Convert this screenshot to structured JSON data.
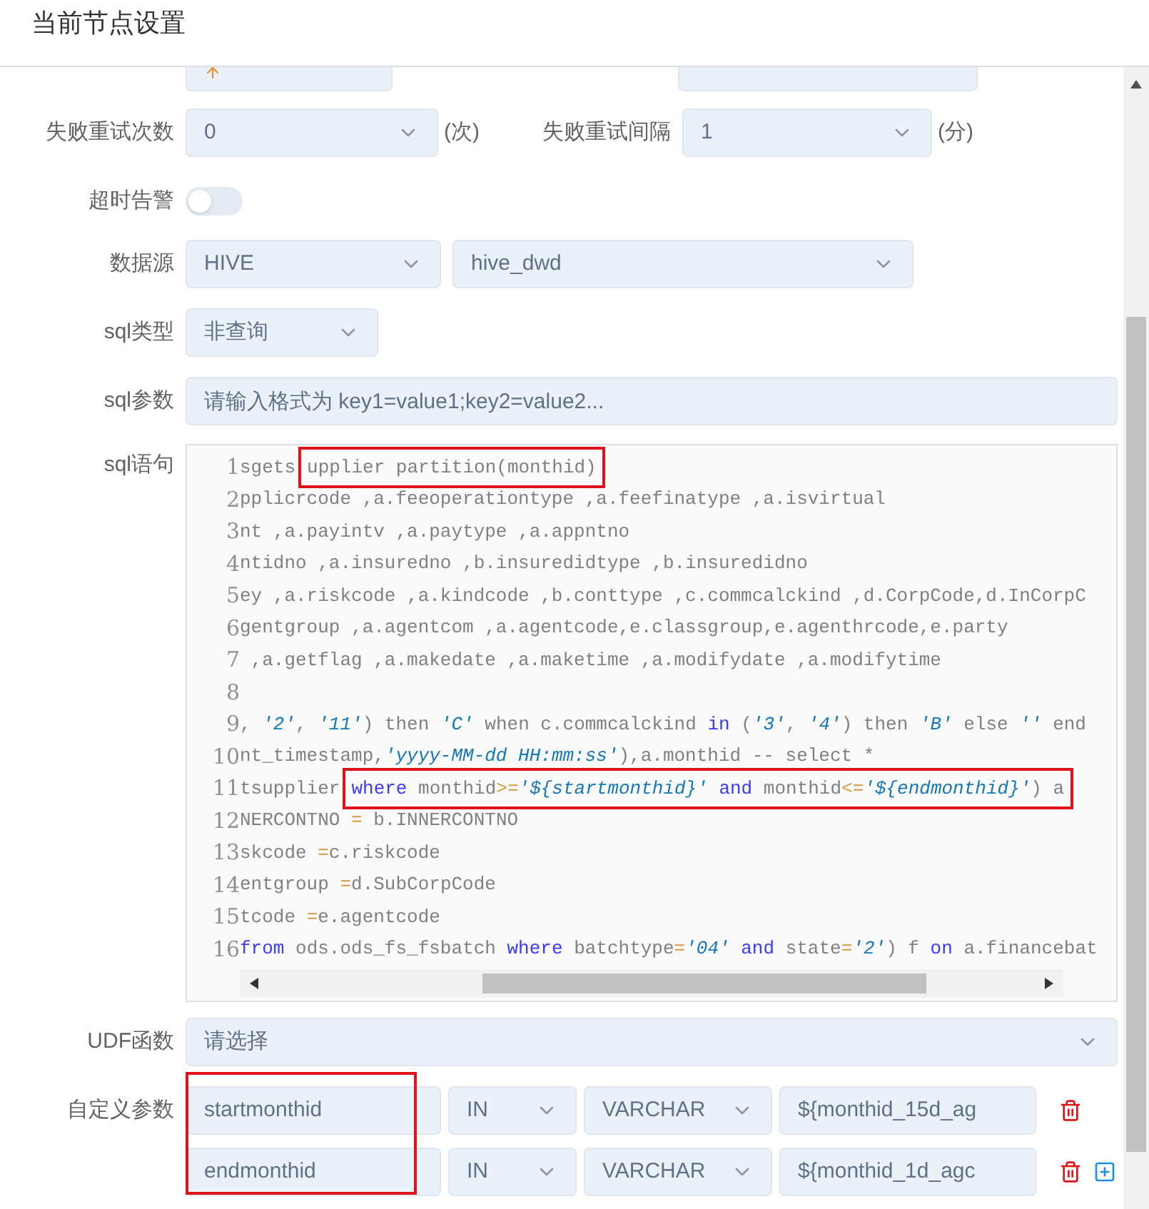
{
  "header": {
    "title": "当前节点设置"
  },
  "form": {
    "retry_row": {
      "retries_label": "失败重试次数",
      "retries_value": "0",
      "retries_unit": "(次)",
      "interval_label": "失败重试间隔",
      "interval_value": "1",
      "interval_unit": "(分)"
    },
    "timeout_alarm": {
      "label": "超时告警",
      "on": false
    },
    "datasource": {
      "label": "数据源",
      "type": "HIVE",
      "name": "hive_dwd"
    },
    "sql_type": {
      "label": "sql类型",
      "value": "非查询"
    },
    "sql_params": {
      "label": "sql参数",
      "placeholder": "请输入格式为 key1=value1;key2=value2..."
    },
    "sql_statement": {
      "label": "sql语句",
      "lines": [
        {
          "number": "1",
          "parts": [
            {
              "boxed": false,
              "tokens": [
                {
                  "text": "sgets",
                  "kind": "plain"
                }
              ]
            },
            {
              "boxed": true,
              "tokens": [
                {
                  "text": "upplier partition(monthid)",
                  "kind": "plain"
                }
              ]
            }
          ]
        },
        {
          "number": "2",
          "parts": [
            {
              "boxed": false,
              "tokens": [
                {
                  "text": "pplicrcode ,a.feeoperationtype ,a.feefinatype ,a.isvirtual",
                  "kind": "plain"
                }
              ]
            }
          ]
        },
        {
          "number": "3",
          "parts": [
            {
              "boxed": false,
              "tokens": [
                {
                  "text": "nt ,a.payintv ,a.paytype ,a.appntno",
                  "kind": "plain"
                }
              ]
            }
          ]
        },
        {
          "number": "4",
          "parts": [
            {
              "boxed": false,
              "tokens": [
                {
                  "text": "ntidno ,a.insuredno ,b.insuredidtype ,b.insuredidno",
                  "kind": "plain"
                }
              ]
            }
          ]
        },
        {
          "number": "5",
          "parts": [
            {
              "boxed": false,
              "tokens": [
                {
                  "text": "ey ,a.riskcode ,a.kindcode ,b.conttype ,c.commcalckind ,d.CorpCode,d.InCorpC",
                  "kind": "plain"
                }
              ]
            }
          ]
        },
        {
          "number": "6",
          "parts": [
            {
              "boxed": false,
              "tokens": [
                {
                  "text": "gentgroup ,a.agentcom ,a.agentcode,e.classgroup,e.agenthrcode,e.party",
                  "kind": "plain"
                }
              ]
            }
          ]
        },
        {
          "number": "7",
          "parts": [
            {
              "boxed": false,
              "tokens": [
                {
                  "text": " ,a.getflag ,a.makedate ,a.maketime ,a.modifydate ,a.modifytime",
                  "kind": "plain"
                }
              ]
            }
          ]
        },
        {
          "number": "8"
        },
        {
          "number": "9",
          "parts": [
            {
              "boxed": false,
              "tokens": [
                {
                  "text": ", ",
                  "kind": "plain"
                },
                {
                  "text": "'2'",
                  "kind": "string"
                },
                {
                  "text": ", ",
                  "kind": "plain"
                },
                {
                  "text": "'11'",
                  "kind": "string"
                },
                {
                  "text": ") then ",
                  "kind": "plain"
                },
                {
                  "text": "'C'",
                  "kind": "string"
                },
                {
                  "text": " when c.commcalckind ",
                  "kind": "plain"
                },
                {
                  "text": "in",
                  "kind": "keyword"
                },
                {
                  "text": " (",
                  "kind": "plain"
                },
                {
                  "text": "'3'",
                  "kind": "string"
                },
                {
                  "text": ", ",
                  "kind": "plain"
                },
                {
                  "text": "'4'",
                  "kind": "string"
                },
                {
                  "text": ") then ",
                  "kind": "plain"
                },
                {
                  "text": "'B'",
                  "kind": "string"
                },
                {
                  "text": " else ",
                  "kind": "plain"
                },
                {
                  "text": "''",
                  "kind": "string"
                },
                {
                  "text": " end",
                  "kind": "plain"
                }
              ]
            }
          ]
        },
        {
          "number": "10",
          "parts": [
            {
              "boxed": false,
              "tokens": [
                {
                  "text": "nt_timestamp,",
                  "kind": "plain"
                },
                {
                  "text": "'yyyy-MM-dd HH:mm:ss'",
                  "kind": "string"
                },
                {
                  "text": "),a.monthid -- select *",
                  "kind": "plain"
                }
              ]
            }
          ]
        },
        {
          "number": "11",
          "parts": [
            {
              "boxed": false,
              "tokens": [
                {
                  "text": "tsupplier",
                  "kind": "plain"
                }
              ]
            },
            {
              "boxed": true,
              "tokens": [
                {
                  "text": "where",
                  "kind": "keyword"
                },
                {
                  "text": " monthid",
                  "kind": "plain"
                },
                {
                  "text": ">=",
                  "kind": "operator"
                },
                {
                  "text": "'${startmonthid}'",
                  "kind": "string"
                },
                {
                  "text": " and",
                  "kind": "keyword"
                },
                {
                  "text": " monthid",
                  "kind": "plain"
                },
                {
                  "text": "<=",
                  "kind": "operator"
                },
                {
                  "text": "'${endmonthid}'",
                  "kind": "string"
                },
                {
                  "text": ") a",
                  "kind": "plain"
                }
              ]
            }
          ]
        },
        {
          "number": "12",
          "parts": [
            {
              "boxed": false,
              "tokens": [
                {
                  "text": "NERCONTNO ",
                  "kind": "plain"
                },
                {
                  "text": "=",
                  "kind": "operator"
                },
                {
                  "text": " b.INNERCONTNO",
                  "kind": "plain"
                }
              ]
            }
          ]
        },
        {
          "number": "13",
          "parts": [
            {
              "boxed": false,
              "tokens": [
                {
                  "text": "skcode ",
                  "kind": "plain"
                },
                {
                  "text": "=",
                  "kind": "operator"
                },
                {
                  "text": "c.riskcode",
                  "kind": "plain"
                }
              ]
            }
          ]
        },
        {
          "number": "14",
          "parts": [
            {
              "boxed": false,
              "tokens": [
                {
                  "text": "entgroup ",
                  "kind": "plain"
                },
                {
                  "text": "=",
                  "kind": "operator"
                },
                {
                  "text": "d.SubCorpCode",
                  "kind": "plain"
                }
              ]
            }
          ]
        },
        {
          "number": "15",
          "parts": [
            {
              "boxed": false,
              "tokens": [
                {
                  "text": "tcode ",
                  "kind": "plain"
                },
                {
                  "text": "=",
                  "kind": "operator"
                },
                {
                  "text": "e.agentcode",
                  "kind": "plain"
                }
              ]
            }
          ]
        },
        {
          "number": "16",
          "parts": [
            {
              "boxed": false,
              "tokens": [
                {
                  "text": "from",
                  "kind": "keyword"
                },
                {
                  "text": " ods.ods_fs_fsbatch ",
                  "kind": "plain"
                },
                {
                  "text": "where",
                  "kind": "keyword"
                },
                {
                  "text": " batchtype",
                  "kind": "plain"
                },
                {
                  "text": "=",
                  "kind": "operator"
                },
                {
                  "text": "'04'",
                  "kind": "string"
                },
                {
                  "text": " and",
                  "kind": "keyword"
                },
                {
                  "text": " state",
                  "kind": "plain"
                },
                {
                  "text": "=",
                  "kind": "operator"
                },
                {
                  "text": "'2'",
                  "kind": "string"
                },
                {
                  "text": ") f ",
                  "kind": "plain"
                },
                {
                  "text": "on",
                  "kind": "keyword"
                },
                {
                  "text": " a.financebat",
                  "kind": "plain"
                }
              ]
            }
          ]
        }
      ]
    },
    "udf": {
      "label": "UDF函数",
      "placeholder": "请选择"
    },
    "custom_params": {
      "label": "自定义参数",
      "highlighted": true,
      "rows": [
        {
          "name": "startmonthid",
          "direction": "IN",
          "type": "VARCHAR",
          "value": "${monthid_15d_ag",
          "can_add": false
        },
        {
          "name": "endmonthid",
          "direction": "IN",
          "type": "VARCHAR",
          "value": "${monthid_1d_agc",
          "can_add": true
        }
      ]
    }
  }
}
